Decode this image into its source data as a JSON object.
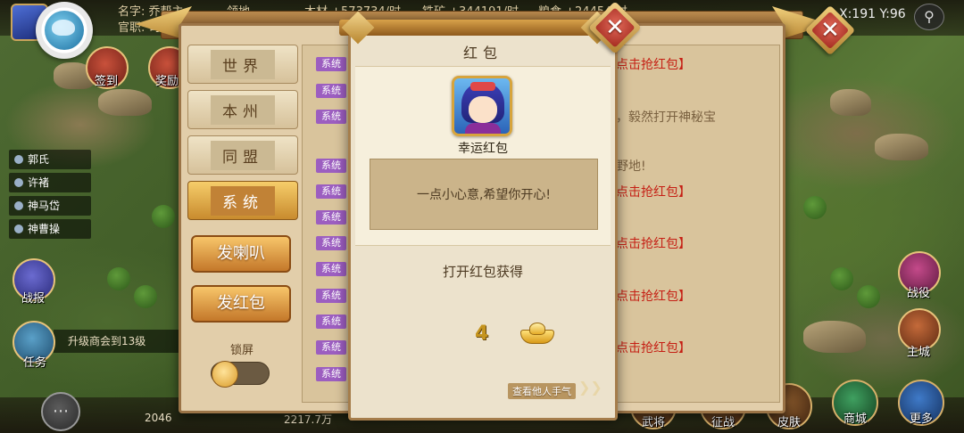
{
  "top_bar": {
    "name_label": "名字: 乔帮主",
    "rank_label": "官职: 司",
    "territory": "领地",
    "wood": "木材 +573734/时",
    "iron": "铁矿 +344191/时",
    "food": "粮食 +24454/时",
    "coords": "X:191 Y:96"
  },
  "side_menu": {
    "sign_in": "签到",
    "reward": "奖励",
    "battle_report": "战报",
    "task": "任务",
    "task_text": "升级商会到13级",
    "campaign": "战役",
    "main_city": "主城"
  },
  "npc_list": [
    "郭氏",
    "许褚",
    "神马岱",
    "神曹操"
  ],
  "chat": {
    "channels": [
      {
        "label": "世界",
        "active": false
      },
      {
        "label": "本州",
        "active": false
      },
      {
        "label": "同盟",
        "active": false
      },
      {
        "label": "系统",
        "active": true
      }
    ],
    "horn_button": "发喇叭",
    "packet_button": "发红包",
    "lock_label": "锁屏",
    "lock_on": false,
    "system_tag": "系统",
    "messages": [
      {
        "text": "点击抢红包】",
        "style": "red"
      },
      {
        "text": "，毅然打开神秘宝",
        "style": "dark"
      },
      {
        "text": "野地!",
        "style": "dark"
      },
      {
        "text": "点击抢红包】",
        "style": "red"
      },
      {
        "text": "点击抢红包】",
        "style": "red"
      },
      {
        "text": "点击抢红包】",
        "style": "red"
      },
      {
        "text": "点击抢红包】",
        "style": "red"
      }
    ]
  },
  "red_packet": {
    "title": "红包",
    "sender_name": "幸运红包",
    "wish": "一点小心意,希望你开心!",
    "reward_label": "打开红包获得",
    "reward_count": "4",
    "reward_icon": "gold-ingot-icon",
    "see_others": "查看他人手气"
  },
  "bottom_bar": {
    "gold": "2046",
    "food_amount": "2217.7万",
    "generals": "武将",
    "expedition": "征战",
    "skin": "皮肤",
    "shop": "商城",
    "more": "更多"
  },
  "colors": {
    "system_tag": "#9c5ec0",
    "red_link": "#c51f14",
    "active_channel": "#c88b2e"
  }
}
